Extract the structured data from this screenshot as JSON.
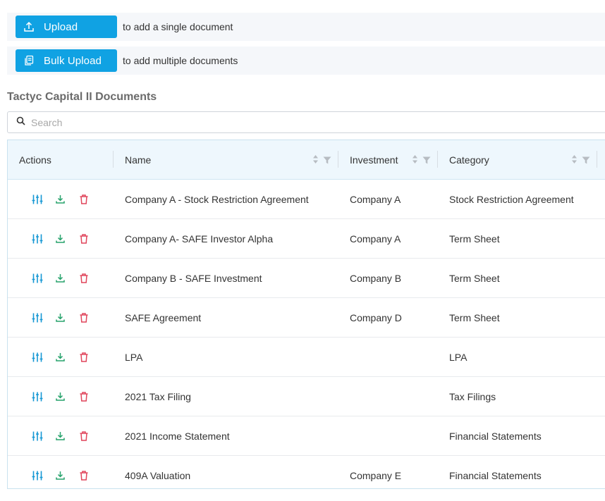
{
  "upload": {
    "single_label": "Upload",
    "single_hint": "to add a single document",
    "bulk_label": "Bulk Upload",
    "bulk_hint": "to add multiple documents"
  },
  "section": {
    "title": "Tactyc Capital II Documents"
  },
  "search": {
    "placeholder": "Search"
  },
  "table": {
    "headers": {
      "actions": "Actions",
      "name": "Name",
      "investment": "Investment",
      "category": "Category"
    },
    "rows": [
      {
        "name": "Company A - Stock Restriction Agreement",
        "investment": "Company A",
        "category": "Stock Restriction Agreement"
      },
      {
        "name": "Company A- SAFE Investor Alpha",
        "investment": "Company A",
        "category": "Term Sheet"
      },
      {
        "name": "Company B - SAFE Investment",
        "investment": "Company B",
        "category": "Term Sheet"
      },
      {
        "name": "SAFE Agreement",
        "investment": "Company D",
        "category": "Term Sheet"
      },
      {
        "name": "LPA",
        "investment": "",
        "category": "LPA"
      },
      {
        "name": "2021 Tax Filing",
        "investment": "",
        "category": "Tax Filings"
      },
      {
        "name": "2021 Income Statement",
        "investment": "",
        "category": "Financial Statements"
      },
      {
        "name": "409A Valuation",
        "investment": "Company E",
        "category": "Financial Statements"
      }
    ]
  },
  "colors": {
    "primary": "#10a2e3",
    "edit_icon": "#1597d4",
    "download_icon": "#26a26b",
    "delete_icon": "#e0455b"
  },
  "icons": {
    "upload": "upload-icon",
    "bulk_upload": "copy-documents-icon",
    "search": "search-icon",
    "edit": "sliders-icon",
    "download": "download-icon",
    "delete": "trash-icon",
    "sort": "sort-icon",
    "filter": "filter-icon"
  }
}
